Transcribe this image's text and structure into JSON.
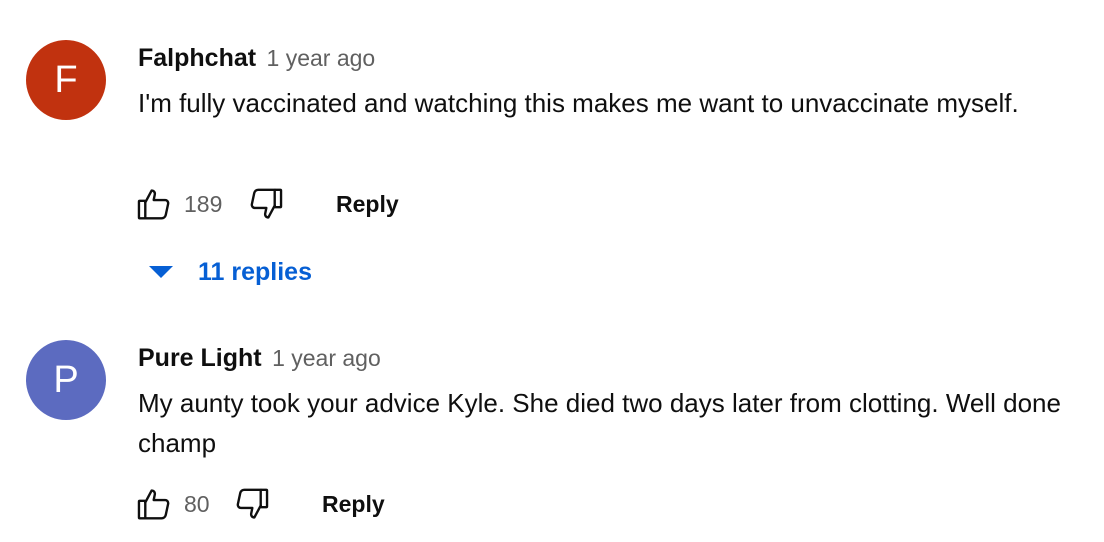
{
  "comments": [
    {
      "avatar_letter": "F",
      "avatar_color": "#c1320f",
      "author": "Falphchat",
      "time": "1 year ago",
      "text": "I'm fully vaccinated and watching this makes me want to unvaccinate myself.",
      "likes": "189",
      "reply_label": "Reply",
      "replies_label": "11 replies"
    },
    {
      "avatar_letter": "P",
      "avatar_color": "#5c6bc0",
      "author": "Pure Light",
      "time": "1 year ago",
      "text": "My aunty took your advice Kyle. She died two days later from clotting. Well done champ",
      "likes": "80",
      "reply_label": "Reply"
    }
  ],
  "icons": {
    "like": "thumbs-up-icon",
    "dislike": "thumbs-down-icon",
    "expand": "caret-down-icon"
  },
  "colors": {
    "link_blue": "#065fd4",
    "secondary_text": "#606060"
  }
}
